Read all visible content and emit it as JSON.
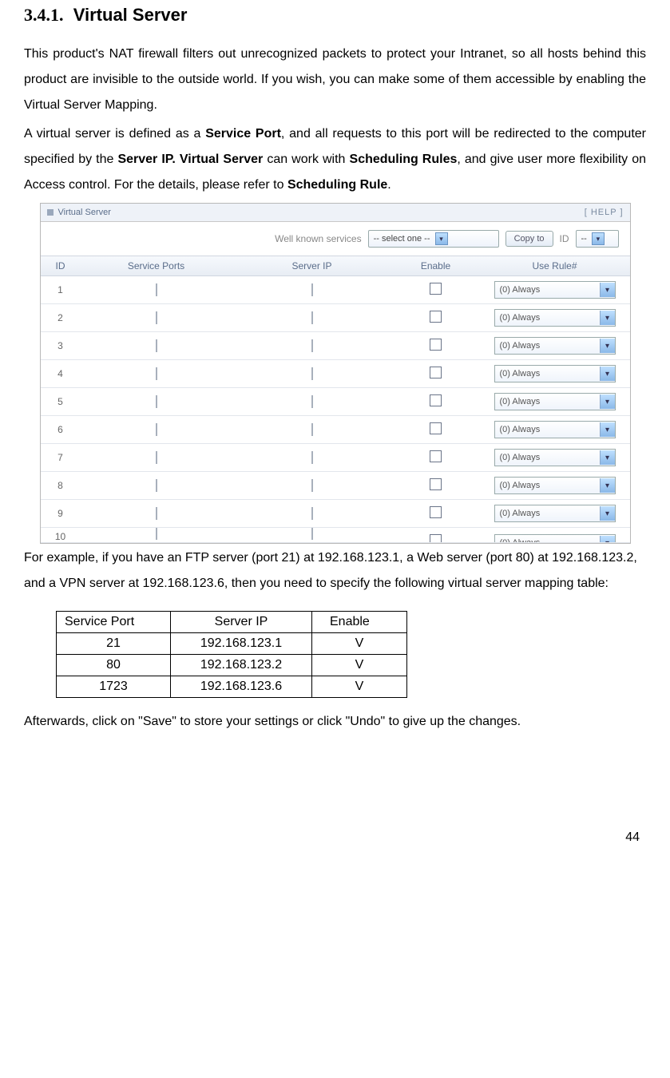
{
  "heading_number": "3.4.1.",
  "heading_title": "Virtual Server",
  "para1_a": "This product's NAT firewall filters out unrecognized packets to protect your Intranet, so all hosts behind this product are invisible to the outside world. If you wish, you can make some of them accessible by enabling the Virtual Server Mapping.",
  "para1_b_pre": "A virtual server is defined as a ",
  "para1_b_bold1": "Service Port",
  "para1_b_mid": ", and all requests to this port will be redirected to the computer specified by the ",
  "para1_b_bold2": "Server IP. Virtual Server",
  "para1_b_mid2": " can work with ",
  "para1_b_bold3": "Scheduling Rules",
  "para1_b_mid3": ", and give user more flexibility on Access control. For the details, please refer to ",
  "para1_b_bold4": "Scheduling Rule",
  "para1_b_end": ".",
  "router": {
    "title": "Virtual Server",
    "help": "[ HELP ]",
    "well_known_label": "Well known services",
    "select_one": "-- select one --",
    "copy_to": "Copy to",
    "id_label": "ID",
    "id_sel": "--",
    "columns": {
      "id": "ID",
      "sp": "Service Ports",
      "ip": "Server IP",
      "en": "Enable",
      "ur": "Use Rule#"
    },
    "rule_option": "(0) Always",
    "rows": [
      "1",
      "2",
      "3",
      "4",
      "5",
      "6",
      "7",
      "8",
      "9"
    ],
    "row_partial": "10"
  },
  "para2": "For example, if you have an FTP server (port 21) at 192.168.123.1, a Web server (port 80) at 192.168.123.2, and a VPN server at 192.168.123.6, then you need to specify the following virtual server mapping table:",
  "map_table": {
    "headers": [
      "Service Port",
      "Server IP",
      "Enable"
    ],
    "rows": [
      {
        "port": "21",
        "ip": "192.168.123.1",
        "enable": "V"
      },
      {
        "port": "80",
        "ip": "192.168.123.2",
        "enable": "V"
      },
      {
        "port": "1723",
        "ip": "192.168.123.6",
        "enable": "V"
      }
    ]
  },
  "para3": "Afterwards, click on \"Save\" to store your settings or click \"Undo\" to give up the changes.",
  "page_number": "44"
}
